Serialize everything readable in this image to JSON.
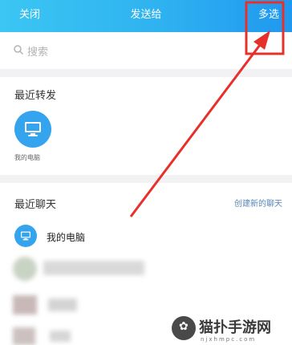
{
  "header": {
    "close": "关闭",
    "title": "发送给",
    "multi_select": "多选",
    "gradient": [
      "#3bc6f3",
      "#1f98ef"
    ]
  },
  "search": {
    "placeholder": "搜索",
    "icon": "search-icon"
  },
  "recent_forward": {
    "title": "最近转发",
    "items": [
      {
        "label": "我的电脑",
        "icon": "monitor-icon"
      }
    ]
  },
  "recent_chats": {
    "title": "最近聊天",
    "create": "创建新的聊天",
    "items": [
      {
        "name": "我的电脑",
        "icon": "monitor-icon"
      }
    ]
  },
  "annotation": {
    "color": "#e8302a",
    "icon": "arrow-annotation"
  },
  "watermark": {
    "name": "猫扑手游网",
    "url": "njxhmpc.com"
  }
}
